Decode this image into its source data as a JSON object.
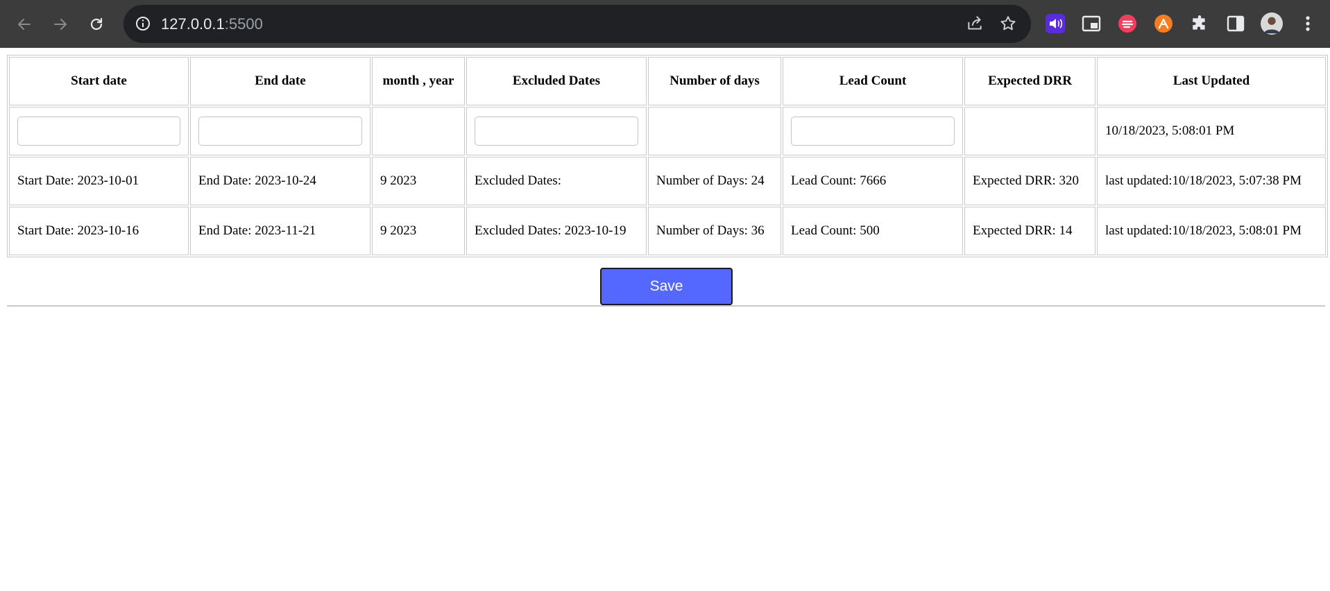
{
  "browser": {
    "url_host": "127.0.0.1",
    "url_port": ":5500",
    "icons": {
      "back": "arrow-left-icon",
      "forward": "arrow-right-icon",
      "reload": "reload-icon",
      "site_info": "info-icon",
      "share": "share-icon",
      "bookmark": "star-icon"
    },
    "extensions": [
      "audio-extension-icon",
      "picture-in-picture-icon",
      "red-extension-icon",
      "orange-extension-icon",
      "puzzle-extensions-icon",
      "side-panel-icon",
      "profile-avatar",
      "kebab-menu-icon"
    ],
    "colors": {
      "toolbar": "#3c3c3c",
      "omnibox": "#202124"
    }
  },
  "table": {
    "headers": [
      "Start date",
      "End date",
      "month , year",
      "Excluded Dates",
      "Number of days",
      "Lead Count",
      "Expected DRR",
      "Last Updated"
    ],
    "input_row": {
      "start_date_value": "",
      "end_date_value": "",
      "excluded_dates_value": "",
      "lead_count_value": "",
      "last_updated": "10/18/2023, 5:08:01 PM"
    },
    "rows": [
      {
        "start": "Start Date: 2023-10-01",
        "end": "End Date: 2023-10-24",
        "month_year": "9 2023",
        "excluded": "Excluded Dates:",
        "days": "Number of Days: 24",
        "lead": "Lead Count: 7666",
        "drr": "Expected DRR: 320",
        "updated": "last updated:10/18/2023, 5:07:38 PM"
      },
      {
        "start": "Start Date: 2023-10-16",
        "end": "End Date: 2023-11-21",
        "month_year": "9 2023",
        "excluded": "Excluded Dates: 2023-10-19",
        "days": "Number of Days: 36",
        "lead": "Lead Count: 500",
        "drr": "Expected DRR: 14",
        "updated": "last updated:10/18/2023, 5:08:01 PM"
      }
    ]
  },
  "actions": {
    "save_label": "Save",
    "save_color": "#5468ff"
  }
}
